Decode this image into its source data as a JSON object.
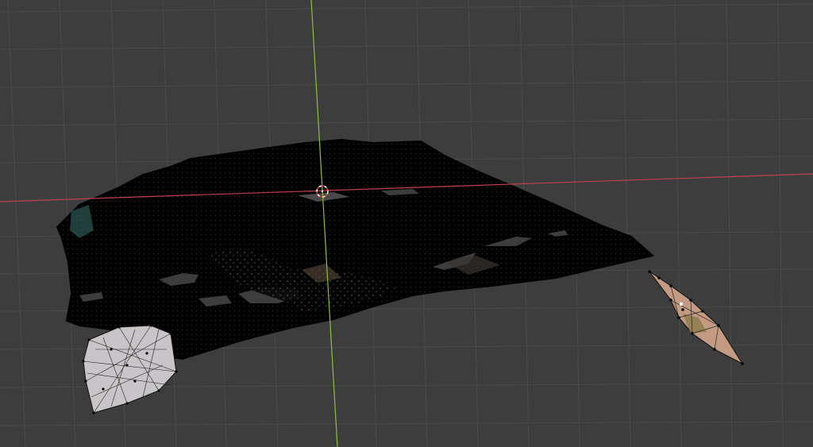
{
  "viewport": {
    "background": "#3d3d3d",
    "grid_color": "#4b4b4b",
    "x_axis_color": "#c0414f",
    "y_axis_color": "#8fbf3a",
    "cursor_icon": "3d-cursor-icon",
    "main_mesh_color": "#000000",
    "wire_vertex_color": "#000000",
    "selected_patch_color": "#c8c4c8",
    "small_mesh_color": "#c49a82"
  }
}
